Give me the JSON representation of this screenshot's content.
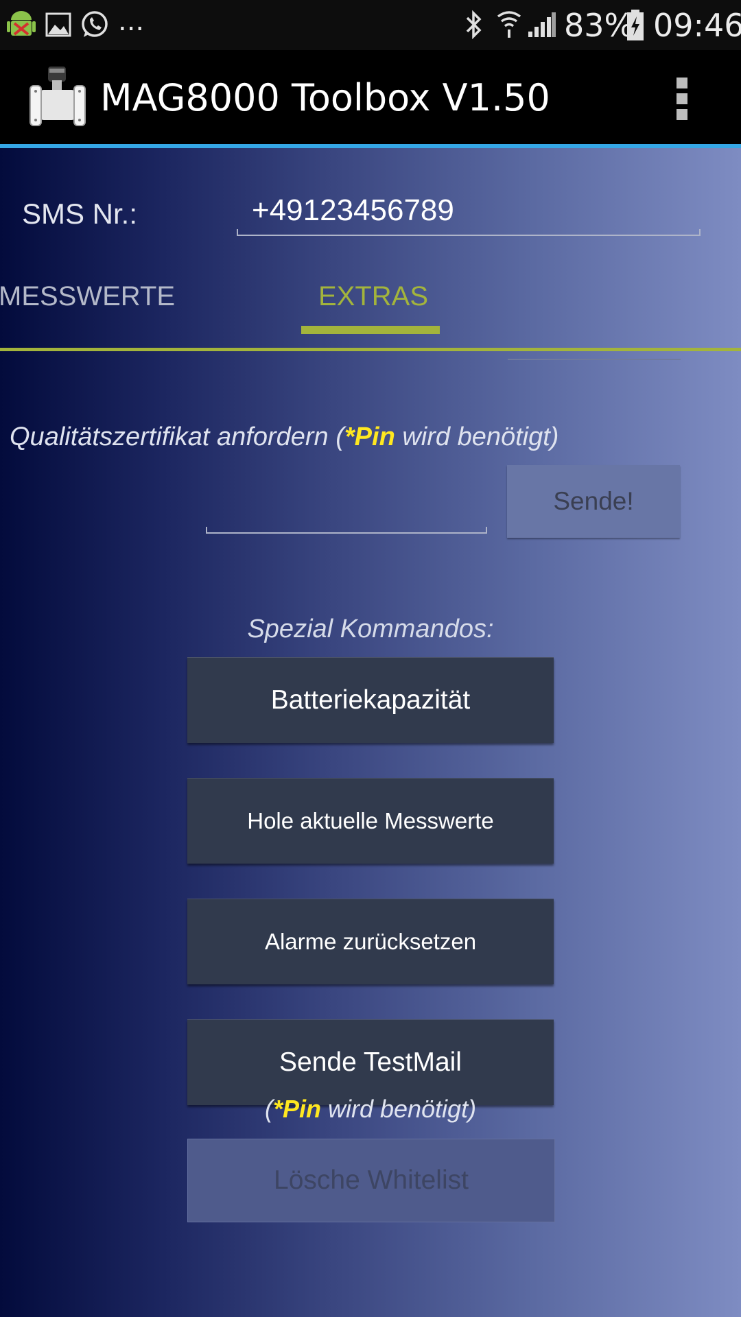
{
  "status_bar": {
    "icons": [
      "android-debug-icon",
      "gallery-icon",
      "whatsapp-icon",
      "bluetooth-icon",
      "wifi-icon",
      "signal-icon",
      "battery-charging-icon"
    ],
    "overflow": "...",
    "battery": "83%",
    "time": "09:46"
  },
  "app_bar": {
    "title": "MAG8000 Toolbox V1.50",
    "logo_icon": "flowmeter-logo-icon",
    "menu_icon": "more-vert-icon"
  },
  "sms": {
    "label": "SMS Nr.:",
    "value": "+49123456789"
  },
  "tabs": [
    {
      "label": "MESSWERTE",
      "selected": false
    },
    {
      "label": "EXTRAS",
      "selected": true
    }
  ],
  "certificate": {
    "heading_prefix": "Qualitätszertifikat anfordern (",
    "heading_pin": "*Pin",
    "heading_suffix": " wird benötigt)",
    "pin_value": "",
    "send_label": "Sende!"
  },
  "special": {
    "label": "Spezial Kommandos:",
    "buttons": [
      {
        "label": "Batteriekapazität",
        "enabled": true
      },
      {
        "label": "Hole aktuelle Messwerte",
        "enabled": true
      },
      {
        "label": "Alarme zurücksetzen",
        "enabled": true
      },
      {
        "label": "Sende TestMail",
        "enabled": true
      },
      {
        "label": "Lösche Whitelist",
        "enabled": false
      }
    ],
    "note_open": "(",
    "note_pin": "*Pin",
    "note_rest": " wird benötigt)"
  },
  "colors": {
    "accent_green": "#a3b43c",
    "highlight_yellow": "#ffe820",
    "divider_blue": "#35a7e6",
    "button_dark": "#313a4d"
  }
}
